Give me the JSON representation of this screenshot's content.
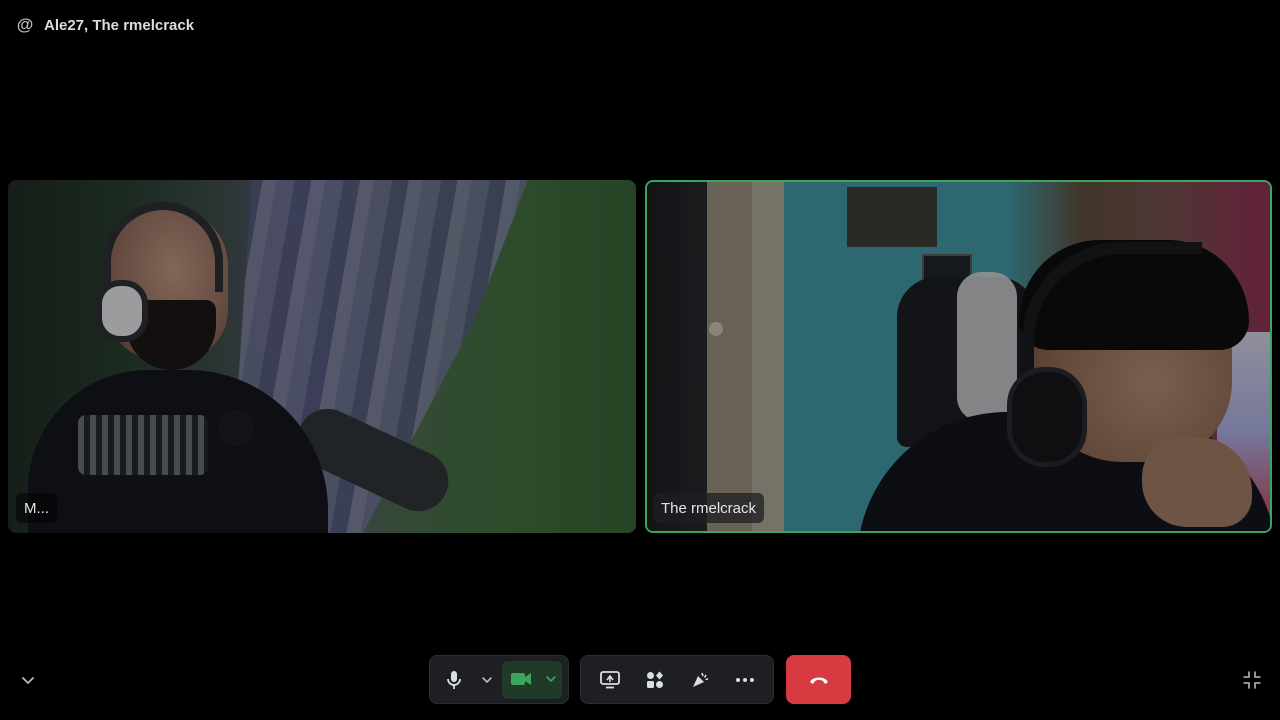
{
  "header": {
    "icon": "at-icon",
    "title": "Ale27, The rmelcrack"
  },
  "participants": [
    {
      "name": "M...",
      "speaking": false
    },
    {
      "name": "The rmelcrack",
      "speaking": true
    }
  ],
  "controls": {
    "microphone_icon": "microphone-icon",
    "camera_icon": "video-camera-icon",
    "camera_active": true,
    "screen_share_icon": "screen-share-icon",
    "activities_icon": "activities-icon",
    "soundboard_icon": "soundboard-icon",
    "more_icon": "more-icon",
    "hangup_icon": "phone-hangup-icon"
  },
  "colors": {
    "background": "#000000",
    "speaking_border": "#3ba55d",
    "camera_active": "#3ba55d",
    "hangup": "#d83a42",
    "control_bg": "#1e1f22"
  }
}
